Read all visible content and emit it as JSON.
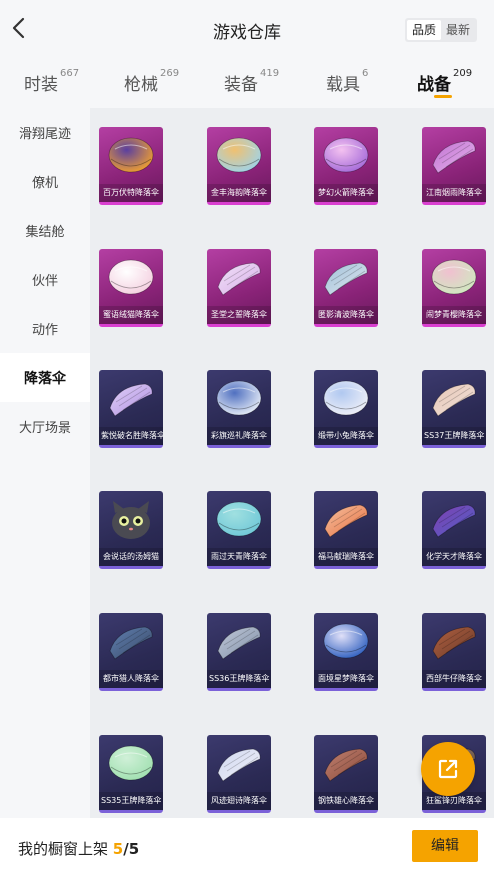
{
  "header": {
    "title": "游戏仓库",
    "sort_options": [
      "品质",
      "最新"
    ],
    "sort_active": 0
  },
  "tabs": [
    {
      "label": "时装",
      "count": "667"
    },
    {
      "label": "枪械",
      "count": "269"
    },
    {
      "label": "装备",
      "count": "419"
    },
    {
      "label": "载具",
      "count": "6"
    },
    {
      "label": "战备",
      "count": "209"
    }
  ],
  "active_tab": 4,
  "sidebar": {
    "items": [
      "滑翔尾迹",
      "僚机",
      "集结舱",
      "伙伴",
      "动作",
      "降落伞",
      "大厅场景"
    ],
    "active": 5
  },
  "items": [
    {
      "name": "百万伏特降落伞",
      "style": "pink",
      "colors": [
        "#f0a030",
        "#5a3fa0"
      ]
    },
    {
      "name": "金丰海韵降落伞",
      "style": "pink",
      "colors": [
        "#9fd3e8",
        "#f0c070"
      ]
    },
    {
      "name": "梦幻火箭降落伞",
      "style": "pink",
      "colors": [
        "#a56bd9",
        "#f4c2f0"
      ]
    },
    {
      "name": "江南烟雨降落伞",
      "style": "pink",
      "colors": [
        "#e8b8f0",
        "#c070d0"
      ]
    },
    {
      "name": "蜜语绒猫降落伞",
      "style": "pink",
      "colors": [
        "#f4d0e0",
        "#ffffff"
      ]
    },
    {
      "name": "圣堂之誓降落伞",
      "style": "pink",
      "colors": [
        "#d8b0e8",
        "#f0e0f8"
      ]
    },
    {
      "name": "匿影清波降落伞",
      "style": "pink",
      "colors": [
        "#e0e8f0",
        "#a0c0d8"
      ]
    },
    {
      "name": "闹梦青樱降落伞",
      "style": "pink",
      "colors": [
        "#d0e8c0",
        "#f0c0d0"
      ]
    },
    {
      "name": "紫悦破名胜降落伞",
      "style": "purple",
      "colors": [
        "#b090e0",
        "#e0d0f8"
      ]
    },
    {
      "name": "彩旗巡礼降落伞",
      "style": "purple",
      "colors": [
        "#e8eef8",
        "#5070c0"
      ]
    },
    {
      "name": "缎带小兔降落伞",
      "style": "purple",
      "colors": [
        "#f0f0f8",
        "#b0c8f0"
      ]
    },
    {
      "name": "SS37王牌降落伞",
      "style": "purple",
      "colors": [
        "#f0e0d8",
        "#e8c8b8"
      ]
    },
    {
      "name": "会说话的汤姆猫",
      "style": "purple",
      "colors": [
        "#4a4a52",
        "#2a2a30"
      ]
    },
    {
      "name": "雨过天青降落伞",
      "style": "purple",
      "colors": [
        "#70c8d8",
        "#a0e0e0"
      ]
    },
    {
      "name": "福马献瑞降落伞",
      "style": "purple",
      "colors": [
        "#e87040",
        "#f4c0a0"
      ]
    },
    {
      "name": "化学天才降落伞",
      "style": "purple",
      "colors": [
        "#5060c8",
        "#8040b0"
      ]
    },
    {
      "name": "都市猎人降落伞",
      "style": "purple",
      "colors": [
        "#3a4a68",
        "#6080b0"
      ]
    },
    {
      "name": "SS36王牌降落伞",
      "style": "purple",
      "colors": [
        "#8090a8",
        "#c0c8d8"
      ]
    },
    {
      "name": "面境星梦降落伞",
      "style": "purple",
      "colors": [
        "#3060c0",
        "#e0e0f8"
      ]
    },
    {
      "name": "西部牛仔降落伞",
      "style": "purple",
      "colors": [
        "#6a3a2a",
        "#b06040"
      ]
    },
    {
      "name": "SS35王牌降落伞",
      "style": "purple",
      "colors": [
        "#a0e0b0",
        "#d0f0d8"
      ]
    },
    {
      "name": "风迹翅诗降落伞",
      "style": "purple",
      "colors": [
        "#f0f0f8",
        "#d0d8f0"
      ]
    },
    {
      "name": "钢铁雄心降落伞",
      "style": "purple",
      "colors": [
        "#8a4a3a",
        "#c08070"
      ]
    },
    {
      "name": "狂鲨锋刃降落伞",
      "style": "purple",
      "colors": [
        "#5a4a40",
        "#a08070"
      ]
    }
  ],
  "bottom": {
    "shelf_label": "我的橱窗上架",
    "shelf_count": "5",
    "shelf_total": "/5",
    "edit_label": "编辑"
  }
}
